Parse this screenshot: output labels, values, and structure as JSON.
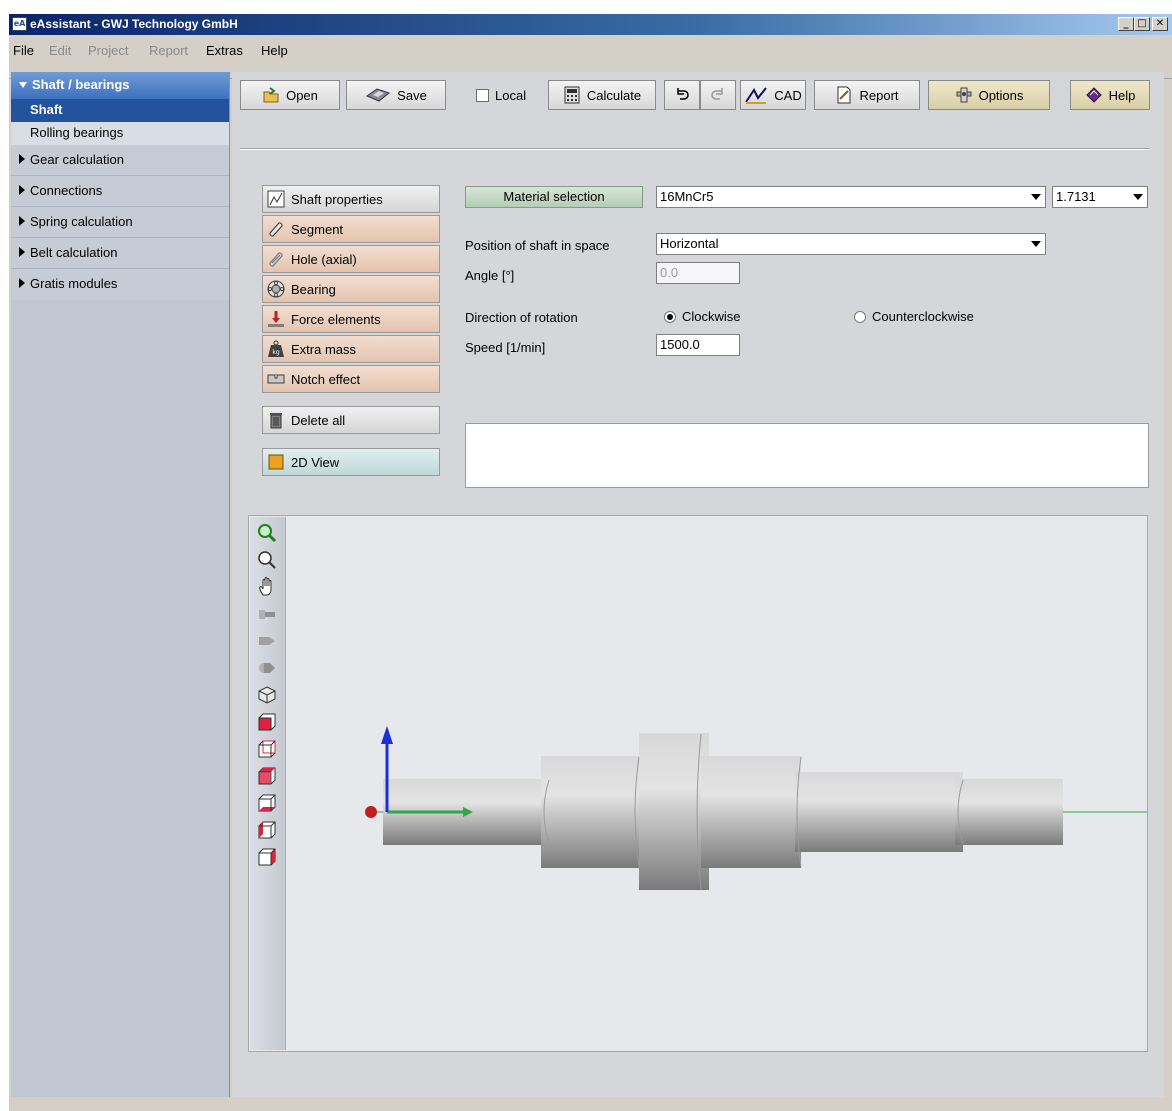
{
  "window": {
    "app_icon_text": "eA",
    "title": "eAssistant - GWJ Technology GmbH",
    "controls": [
      "_",
      "□",
      "✕"
    ]
  },
  "menu": {
    "items": [
      {
        "label": "File",
        "enabled": true
      },
      {
        "label": "Edit",
        "enabled": false
      },
      {
        "label": "Project",
        "enabled": false
      },
      {
        "label": "Report",
        "enabled": false
      },
      {
        "label": "Extras",
        "enabled": true
      },
      {
        "label": "Help",
        "enabled": true
      }
    ]
  },
  "sidebar": {
    "header": "Shaft / bearings",
    "sub_items": [
      "Shaft",
      "Rolling bearings"
    ],
    "active_sub_item": "Shaft",
    "groups": [
      "Gear calculation",
      "Connections",
      "Spring calculation",
      "Belt calculation",
      "Gratis modules"
    ]
  },
  "toolbar": {
    "open": "Open",
    "save": "Save",
    "local": "Local",
    "local_checked": false,
    "calculate": "Calculate",
    "cad": "CAD",
    "report": "Report",
    "options": "Options",
    "help": "Help"
  },
  "elements": {
    "shaft_properties": "Shaft properties",
    "segment": "Segment",
    "hole_axial": "Hole (axial)",
    "bearing": "Bearing",
    "force_elements": "Force elements",
    "extra_mass": "Extra mass",
    "notch_effect": "Notch effect",
    "delete_all": "Delete all",
    "view_2d": "2D View"
  },
  "properties": {
    "material_selection_label": "Material selection",
    "material_value": "16MnCr5",
    "material_number": "1.7131",
    "position_label": "Position of shaft in space",
    "position_value": "Horizontal",
    "angle_label": "Angle [°]",
    "angle_value": "0.0",
    "direction_label": "Direction of rotation",
    "direction_options": [
      "Clockwise",
      "Counterclockwise"
    ],
    "direction_selected": "Clockwise",
    "speed_label": "Speed [1/min]",
    "speed_value": "1500.0"
  },
  "view3d": {
    "tools": [
      "zoom-in-icon",
      "zoom-icon",
      "pan-hand-icon",
      "view-shaft-side-icon",
      "view-shaft-left-icon",
      "view-shaft-right-icon",
      "view-iso-icon",
      "view-cube-front-icon",
      "view-cube-back-icon",
      "view-cube-top-icon",
      "view-cube-bottom-icon",
      "view-cube-left-icon",
      "view-cube-right-icon"
    ],
    "axis_colors": {
      "x": "#2ea84a",
      "y": "#1a2fd6",
      "origin": "#c02020"
    },
    "shaft_color": "#c9c9c9"
  },
  "colors": {
    "sidebar_header": "#3e71be",
    "sidebar_active": "#23539c"
  }
}
